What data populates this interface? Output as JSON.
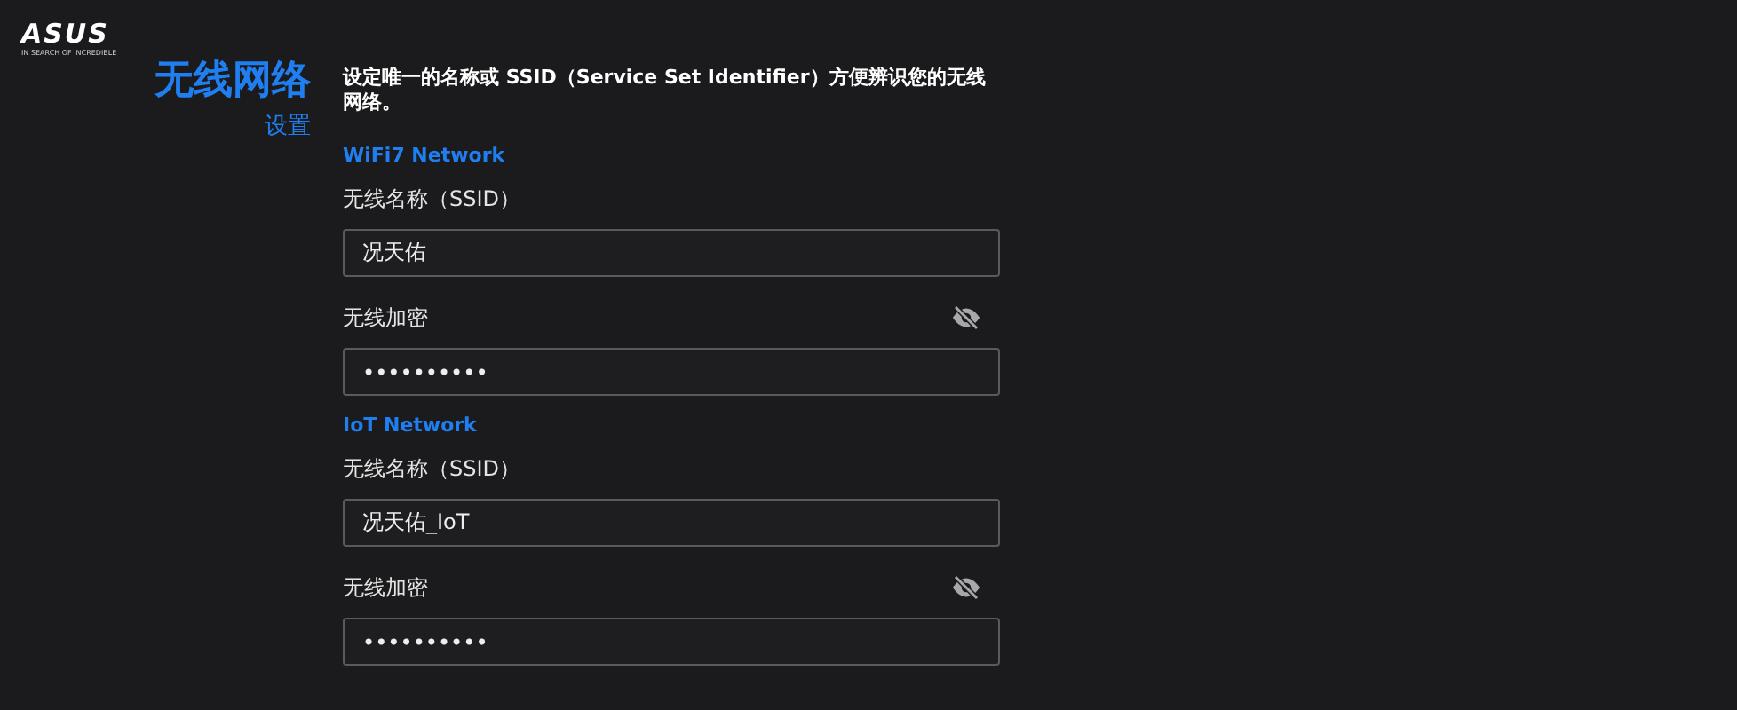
{
  "logo": {
    "brand": "ASUS",
    "tagline": "IN SEARCH OF INCREDIBLE"
  },
  "heading": {
    "title": "无线网络",
    "subtitle": "设置"
  },
  "description": "设定唯一的名称或 SSID（Service Set Identifier）方便辨识您的无线网络。",
  "sections": [
    {
      "title": "WiFi7 Network",
      "fields": [
        {
          "kind": "text",
          "label": "无线名称（SSID）",
          "value": "况天佑"
        },
        {
          "kind": "password",
          "label": "无线加密",
          "value": "••••••••••",
          "visible": false
        }
      ]
    },
    {
      "title": "IoT Network",
      "fields": [
        {
          "kind": "text",
          "label": "无线名称（SSID）",
          "value": "况天佑_IoT"
        },
        {
          "kind": "password",
          "label": "无线加密",
          "value": "••••••••••",
          "visible": false
        }
      ]
    }
  ]
}
